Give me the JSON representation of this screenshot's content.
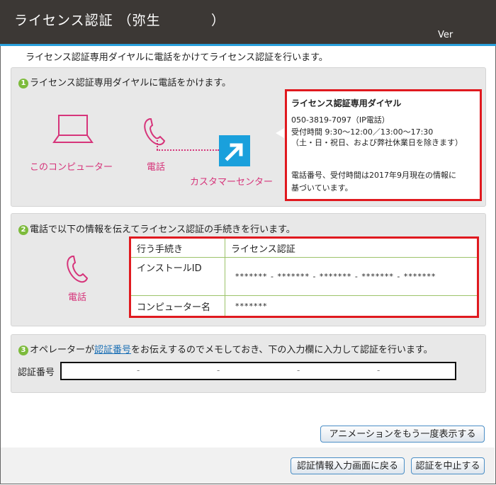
{
  "window": {
    "title": "ライセンス認証 （弥生",
    "title_close": "）",
    "version_label": "Ver"
  },
  "intro": "ライセンス認証専用ダイヤルに電話をかけてライセンス認証を行います。",
  "step1": {
    "number": "1",
    "heading": "ライセンス認証専用ダイヤルに電話をかけます。",
    "computer_label": "このコンピューター",
    "phone_label": "電話",
    "center_label": "カスタマーセンター",
    "info": {
      "title": "ライセンス認証専用ダイヤル",
      "phone": "050-3819-7097（IP電話）",
      "hours": "受付時間 9:30～12:00／13:00～17:30",
      "closed": "（土・日・祝日、および弊社休業日を除きます）",
      "note1": "電話番号、受付時間は2017年9月現在の情報に",
      "note2": "基づいています。"
    }
  },
  "step2": {
    "number": "2",
    "heading": "電話で以下の情報を伝えてライセンス認証の手続きを行います。",
    "phone_label": "電話",
    "rows": [
      {
        "key": "行う手続き",
        "value": "ライセンス認証"
      },
      {
        "key": "インストールID",
        "value": "******* - ******* - ******* - ******* - *******"
      },
      {
        "key": "コンピューター名",
        "value": "*******"
      }
    ]
  },
  "step3": {
    "number": "3",
    "heading_pre": "オペレーターが",
    "heading_link": "認証番号",
    "heading_post": "をお伝えするのでメモしておき、下の入力欄に入力して認証を行います。",
    "code_label": "認証番号",
    "separator": "-"
  },
  "buttons": {
    "replay": "アニメーションをもう一度表示する",
    "back": "認証情報入力画面に戻る",
    "cancel": "認証を中止する"
  },
  "colors": {
    "accent": "#29a0dc",
    "pink": "#d6347a",
    "highlight": "#e0191f",
    "step_badge": "#7dbb3c"
  }
}
